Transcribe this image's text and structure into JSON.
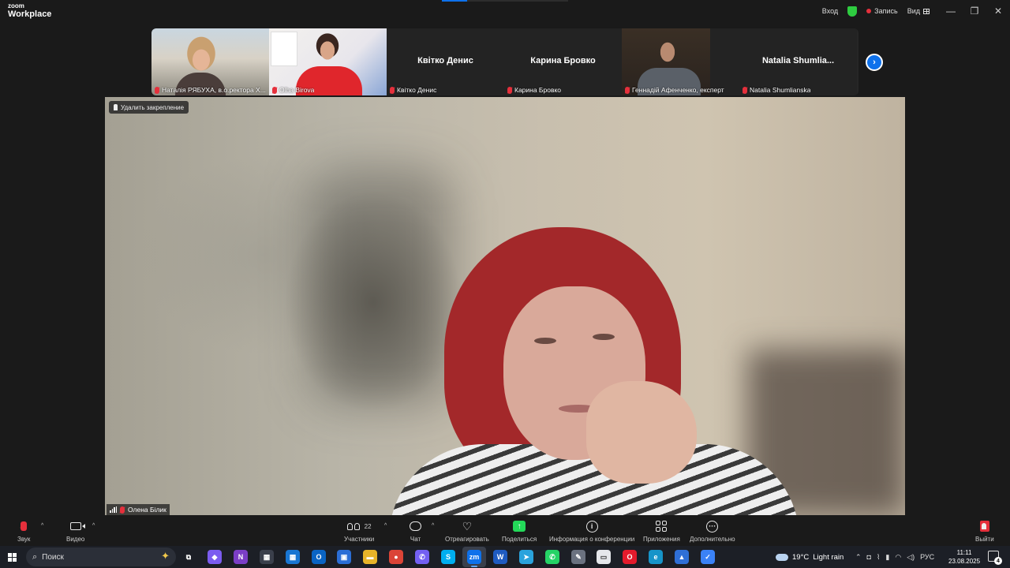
{
  "app": {
    "logo_top": "zoom",
    "logo_bottom": "Workplace"
  },
  "titlebar": {
    "signin": "Вход",
    "recording": "Запись",
    "view": "Вид",
    "minimize": "—",
    "restore": "❐",
    "close": "✕"
  },
  "thumbnails": [
    {
      "name": "Наталія РЯБУХА, в.о.ректора Х...",
      "video": true
    },
    {
      "name": "Olha Birova",
      "video": true
    },
    {
      "name": "Квітко Денис",
      "big_name": "Квітко Денис",
      "video": false
    },
    {
      "name": "Карина Бровко",
      "big_name": "Карина Бровко",
      "video": false
    },
    {
      "name": "Геннадій Афенченко, експерт",
      "video": true
    },
    {
      "name": "Natalia Shumlianska",
      "big_name": "Natalia  Shumlia...",
      "video": false
    }
  ],
  "main_video": {
    "unpin_label": "Удалить закрепление",
    "speaker_name": "Олена Білик"
  },
  "toolbar": {
    "audio": "Звук",
    "video": "Видео",
    "participants": "Участники",
    "participants_count": "22",
    "chat": "Чат",
    "react": "Отреагировать",
    "share": "Поделиться",
    "info": "Информация о конференции",
    "apps": "Приложения",
    "more": "Дополнительно",
    "leave": "Выйти"
  },
  "taskbar": {
    "search_placeholder": "Поиск",
    "weather_temp": "19°C",
    "weather_desc": "Light rain",
    "lang": "РУС",
    "time": "11:11",
    "date": "23.08.2025",
    "notifications": "4",
    "apps": [
      {
        "name": "task-view",
        "label": "⧉",
        "color": "transparent"
      },
      {
        "name": "copilot",
        "label": "◆",
        "color": "#7b5cf0"
      },
      {
        "name": "onenote",
        "label": "N",
        "color": "#7b3ec6"
      },
      {
        "name": "calculator",
        "label": "▦",
        "color": "#3a3f4b"
      },
      {
        "name": "calendar",
        "label": "▦",
        "color": "#1976d2"
      },
      {
        "name": "outlook",
        "label": "O",
        "color": "#0a64c4"
      },
      {
        "name": "store",
        "label": "▣",
        "color": "#2b6ed6"
      },
      {
        "name": "explorer",
        "label": "▬",
        "color": "#e8b429"
      },
      {
        "name": "chrome",
        "label": "●",
        "color": "#db4437"
      },
      {
        "name": "viber",
        "label": "✆",
        "color": "#7360f2"
      },
      {
        "name": "skype",
        "label": "S",
        "color": "#00aff0"
      },
      {
        "name": "zoom",
        "label": "zm",
        "color": "#0e71eb"
      },
      {
        "name": "word",
        "label": "W",
        "color": "#1f5bc1"
      },
      {
        "name": "telegram",
        "label": "➤",
        "color": "#2aa3dd"
      },
      {
        "name": "whatsapp",
        "label": "✆",
        "color": "#25d366"
      },
      {
        "name": "paint",
        "label": "✎",
        "color": "#6b7280"
      },
      {
        "name": "notepad",
        "label": "▭",
        "color": "#e5e7eb"
      },
      {
        "name": "opera",
        "label": "O",
        "color": "#e41b2c"
      },
      {
        "name": "edge",
        "label": "e",
        "color": "#1694c9"
      },
      {
        "name": "image-viewer",
        "label": "▲",
        "color": "#2f6fd6"
      },
      {
        "name": "todo",
        "label": "✓",
        "color": "#3b82f6"
      }
    ]
  }
}
